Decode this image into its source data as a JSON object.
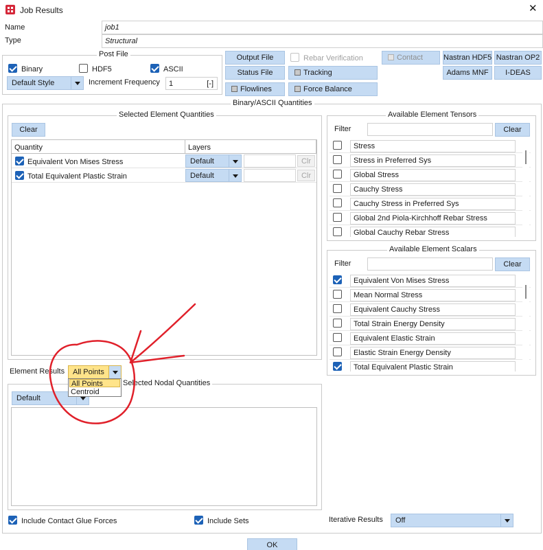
{
  "window": {
    "title": "Job Results",
    "close_symbol": "✕"
  },
  "name_row": {
    "label": "Name",
    "value": "job1"
  },
  "type_row": {
    "label": "Type",
    "value": "Structural"
  },
  "post_file": {
    "title": "Post File",
    "binary": {
      "label": "Binary",
      "checked": true
    },
    "hdf5": {
      "label": "HDF5",
      "checked": false
    },
    "ascii": {
      "label": "ASCII",
      "checked": true
    },
    "style": "Default Style",
    "increment_label": "Increment Frequency",
    "increment_value": "1",
    "increment_btn": "[-]"
  },
  "buttons": {
    "output_file": "Output File",
    "rebar_verification": "Rebar Verification",
    "contact": "Contact",
    "nastran_hdf5": "Nastran HDF5",
    "nastran_op2": "Nastran OP2",
    "status_file": "Status File",
    "tracking": "Tracking",
    "adams_mnf": "Adams MNF",
    "ideas": "I-DEAS",
    "flowlines": "Flowlines",
    "force_balance": "Force Balance"
  },
  "binary_ascii": {
    "title": "Binary/ASCII Quantities"
  },
  "selected_element": {
    "title": "Selected Element Quantities",
    "clear": "Clear",
    "col_quantity": "Quantity",
    "col_layers": "Layers",
    "rows": [
      {
        "name": "Equivalent Von Mises Stress",
        "layer": "Default",
        "clr": "Clr"
      },
      {
        "name": "Total Equivalent Plastic Strain",
        "layer": "Default",
        "clr": "Clr"
      }
    ]
  },
  "tensors": {
    "title": "Available Element Tensors",
    "filter_label": "Filter",
    "clear": "Clear",
    "items": [
      {
        "name": "Stress",
        "checked": false
      },
      {
        "name": "Stress in Preferred Sys",
        "checked": false
      },
      {
        "name": "Global Stress",
        "checked": false
      },
      {
        "name": "Cauchy Stress",
        "checked": false
      },
      {
        "name": "Cauchy Stress in Preferred Sys",
        "checked": false
      },
      {
        "name": "Global 2nd Piola-Kirchhoff Rebar Stress",
        "checked": false
      },
      {
        "name": "Global Cauchy Rebar Stress",
        "checked": false
      }
    ]
  },
  "scalars": {
    "title": "Available Element Scalars",
    "filter_label": "Filter",
    "clear": "Clear",
    "items": [
      {
        "name": "Equivalent Von Mises Stress",
        "checked": true
      },
      {
        "name": "Mean Normal Stress",
        "checked": false
      },
      {
        "name": "Equivalent Cauchy Stress",
        "checked": false
      },
      {
        "name": "Total Strain Energy Density",
        "checked": false
      },
      {
        "name": "Equivalent Elastic Strain",
        "checked": false
      },
      {
        "name": "Elastic Strain Energy Density",
        "checked": false
      },
      {
        "name": "Total Equivalent Plastic Strain",
        "checked": true
      }
    ]
  },
  "element_results": {
    "label": "Element Results",
    "selected": "All Points",
    "options": [
      "All Points",
      "Centroid"
    ]
  },
  "nodal": {
    "title": "Selected Nodal Quantities",
    "combo": "Default"
  },
  "bottom": {
    "contact_glue": {
      "label": "Include Contact Glue Forces",
      "checked": true
    },
    "include_sets": {
      "label": "Include Sets",
      "checked": true
    },
    "iterative_label": "Iterative Results",
    "iterative_value": "Off",
    "ok": "OK"
  },
  "annotation_color": "#e0202a"
}
